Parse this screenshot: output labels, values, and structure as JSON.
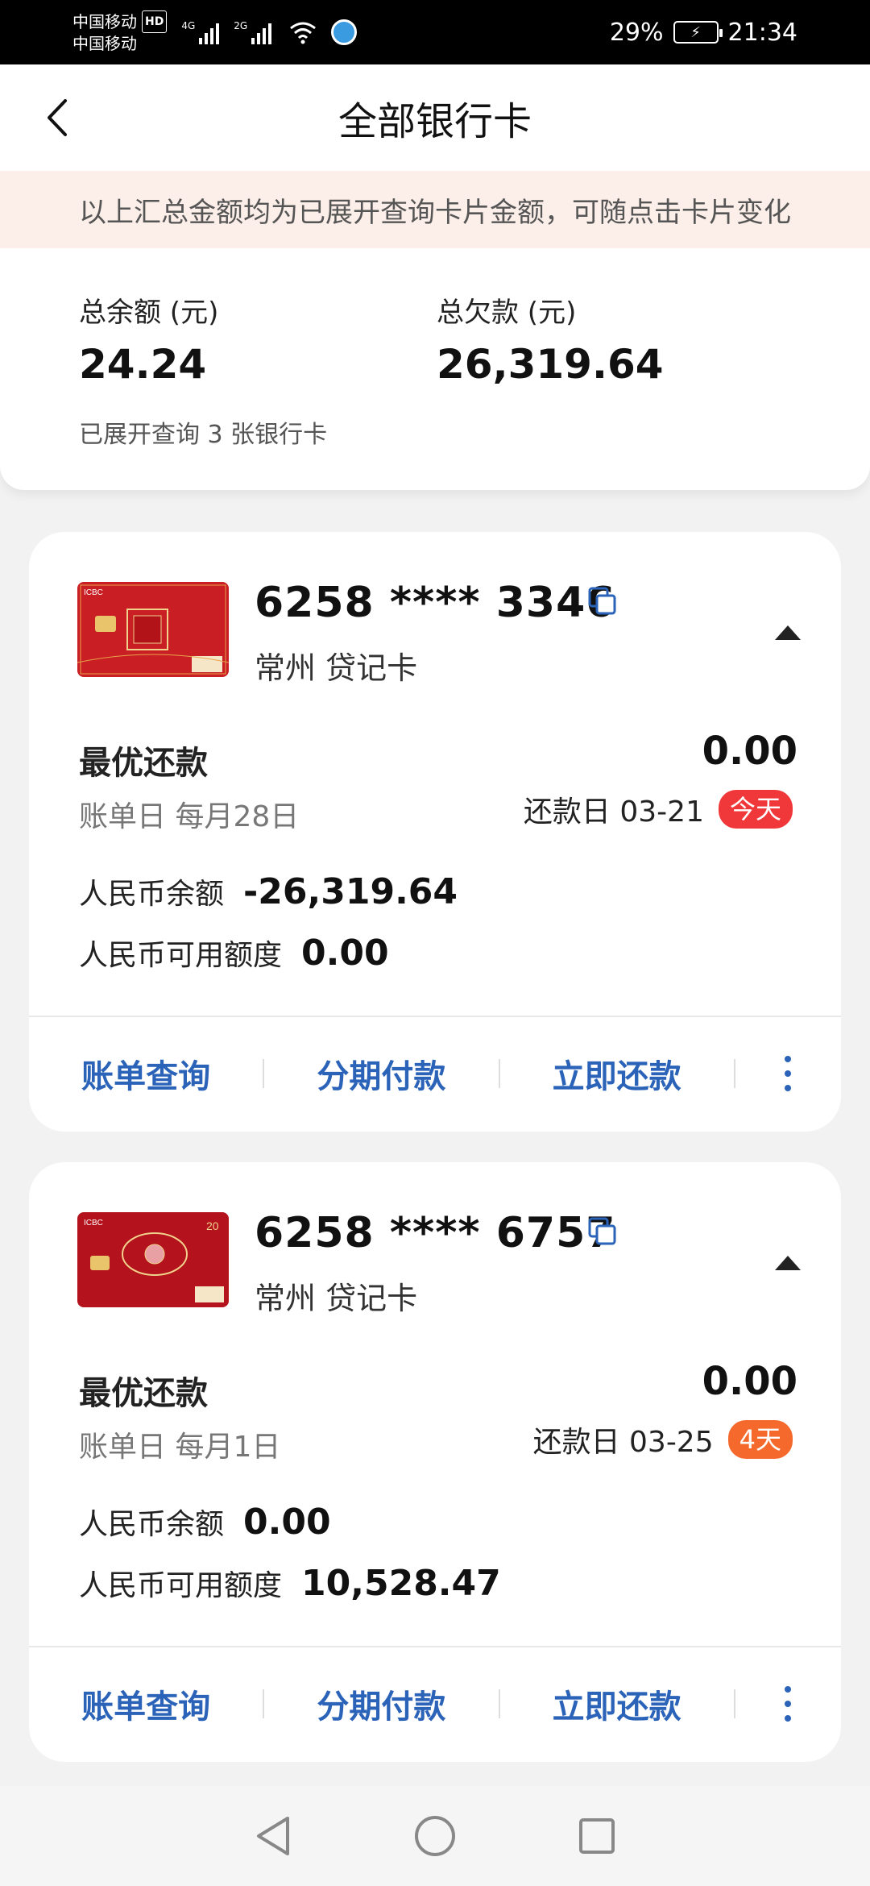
{
  "status_bar": {
    "carrier1": "中国移动",
    "carrier2": "中国移动",
    "hd": "HD",
    "net1": "4G",
    "net2": "2G",
    "battery_percent": "29%",
    "time": "21:34"
  },
  "header": {
    "title": "全部银行卡"
  },
  "notice": "以上汇总金额均为已展开查询卡片金额，可随点击卡片变化",
  "summary": {
    "balance_label": "总余额 (元)",
    "balance_value": "24.24",
    "debt_label": "总欠款 (元)",
    "debt_value": "26,319.64",
    "note": "已展开查询 3 张银行卡"
  },
  "cards": [
    {
      "number": "6258 **** 3346",
      "subtitle": "常州 贷记卡",
      "min_pay_label": "最优还款",
      "min_pay_value": "0.00",
      "bill_day": "账单日  每月28日",
      "due_date": "还款日 03-21",
      "due_badge": "今天",
      "due_badge_color": "#f0383a",
      "balance_label": "人民币余额",
      "balance_value": "-26,319.64",
      "credit_label": "人民币可用额度",
      "credit_value": "0.00",
      "actions": [
        "账单查询",
        "分期付款",
        "立即还款"
      ]
    },
    {
      "number": "6258 **** 6757",
      "subtitle": "常州 贷记卡",
      "min_pay_label": "最优还款",
      "min_pay_value": "0.00",
      "bill_day": "账单日  每月1日",
      "due_date": "还款日 03-25",
      "due_badge": "4天",
      "due_badge_color": "#f56a2c",
      "balance_label": "人民币余额",
      "balance_value": "0.00",
      "credit_label": "人民币可用额度",
      "credit_value": "10,528.47",
      "actions": [
        "账单查询",
        "分期付款",
        "立即还款"
      ]
    }
  ],
  "icons": {
    "back": "back-arrow-icon",
    "copy": "copy-icon",
    "collapse": "caret-up-icon",
    "more": "more-vertical-icon",
    "nav_back": "triangle-back-icon",
    "nav_home": "circle-home-icon",
    "nav_recent": "square-recent-icon"
  },
  "colors": {
    "accent_blue": "#2a63b8",
    "notice_bg": "#fceee8",
    "card_red": "#c81e24"
  }
}
